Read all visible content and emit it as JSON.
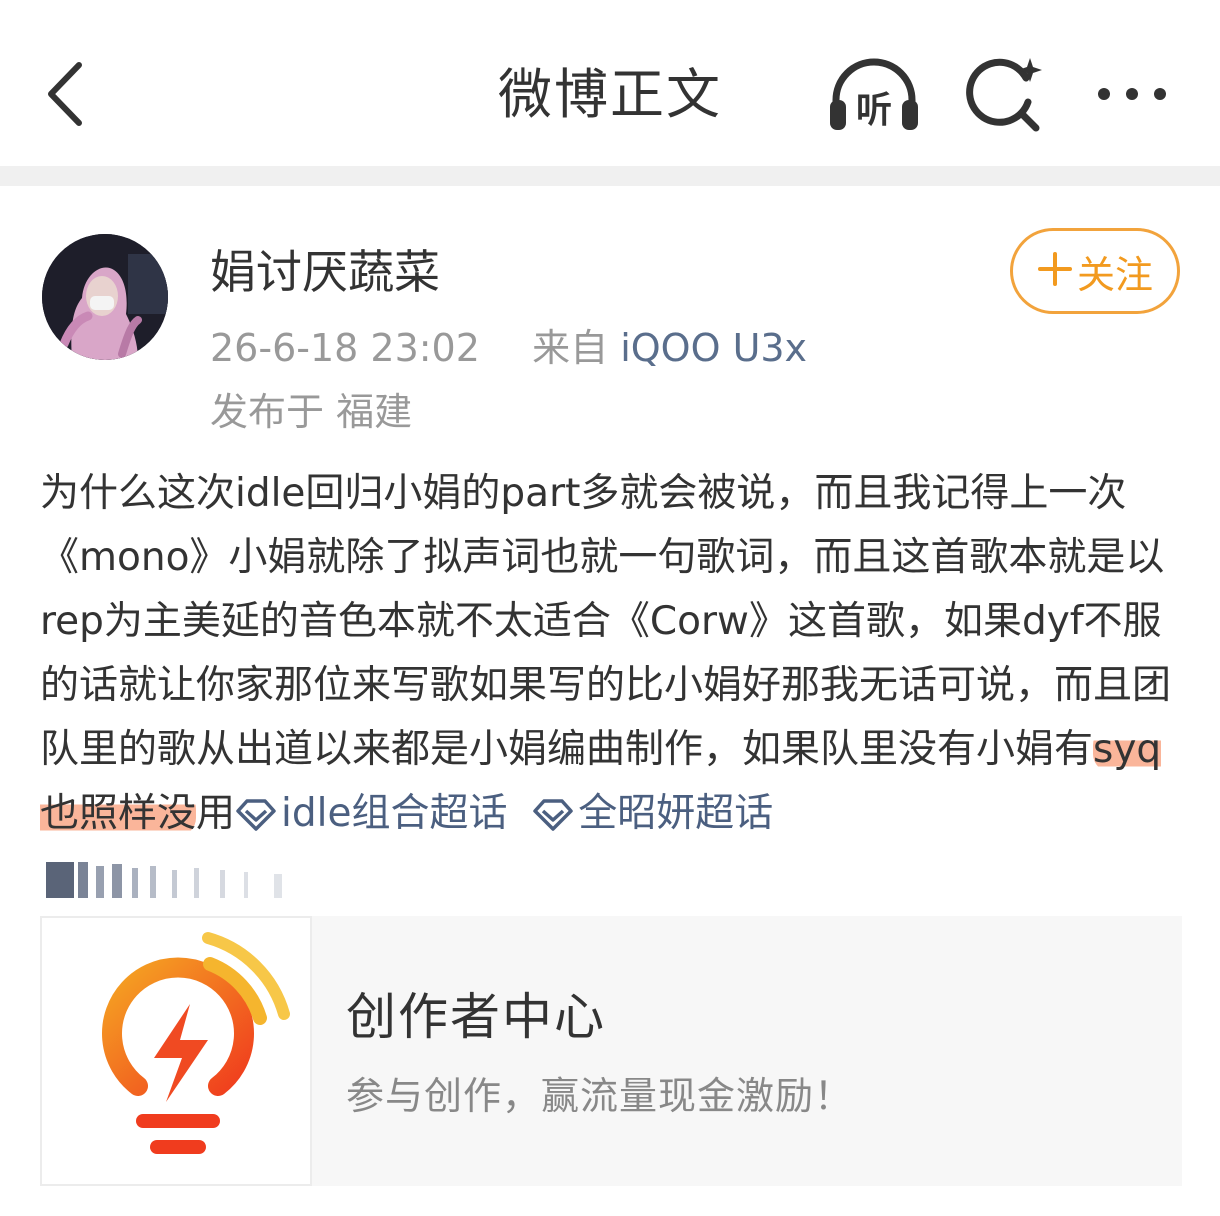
{
  "header": {
    "title": "微博正文",
    "back_icon": "chevron-left-icon",
    "listen_label": "听",
    "search_icon": "search-sparkle-icon",
    "more_icon": "more-dots-icon"
  },
  "post": {
    "author": {
      "name": "娟讨厌蔬菜",
      "avatar": "user-avatar"
    },
    "timestamp": "26-6-18 23:02",
    "source_prefix": "来自",
    "source_device": "iQOO U3x",
    "location": "发布于 福建",
    "follow_label": "关注",
    "text_before": "为什么这次idle回归小娟的part多就会被说，而且我记得上一次《mono》小娟就除了拟声词也就一句歌词，而且这首歌本就是以rep为主美延的音色本就不太适合《Corw》这首歌，如果dyf不服的话就让你家那位来写歌如果写的比小娟好那我无话可说，而且团队里的歌从出道以来都是小娟编曲制作，如果队里没有小娟有",
    "text_highlighted": "syq也照样没",
    "text_after": "用",
    "topics": [
      {
        "label": "idle组合超话"
      },
      {
        "label": "全昭妍超话"
      }
    ]
  },
  "card": {
    "title": "创作者中心",
    "subtitle": "参与创作，赢流量现金激励！",
    "icon": "lightning-bulb-icon"
  },
  "colors": {
    "accent_orange": "#f29a1f",
    "link_blue": "#4b5f80",
    "highlight": "#f89c78"
  }
}
